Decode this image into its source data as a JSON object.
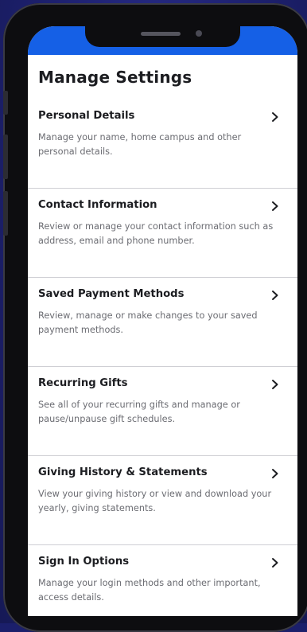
{
  "page": {
    "title": "Manage Settings"
  },
  "settings": [
    {
      "title": "Personal Details",
      "description": "Manage your name, home campus and other personal details."
    },
    {
      "title": "Contact Information",
      "description": "Review or manage your contact information such as address, email and phone number."
    },
    {
      "title": "Saved Payment Methods",
      "description": "Review, manage or make changes to your saved payment methods."
    },
    {
      "title": "Recurring Gifts",
      "description": "See all of your recurring gifts and manage or pause/unpause gift schedules."
    },
    {
      "title": "Giving History & Statements",
      "description": "View your giving history or view and download your yearly, giving statements."
    },
    {
      "title": "Sign In Options",
      "description": "Manage your login methods and other important, access details."
    }
  ],
  "icons": {
    "item_arrow": "chevron-right-icon"
  },
  "colors": {
    "status_bar": "#1560e6",
    "background": "#1d206e",
    "title_text": "#1c1d21",
    "body_text": "#6b6c72",
    "divider": "#cfcfd4"
  }
}
